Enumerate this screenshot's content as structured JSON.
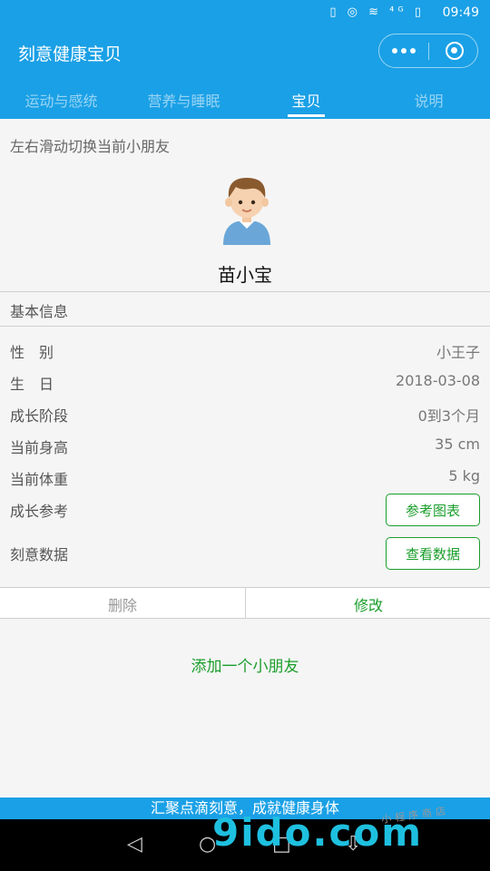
{
  "status_bar": {
    "icons": "▯ ◎ ≋ ⁴ᴳ ▯",
    "time": "09:49"
  },
  "header": {
    "title": "刻意健康宝贝"
  },
  "tabs": [
    {
      "label": "运动与感统",
      "active": false
    },
    {
      "label": "营养与睡眠",
      "active": false
    },
    {
      "label": "宝贝",
      "active": true
    },
    {
      "label": "说明",
      "active": false
    }
  ],
  "hint": "左右滑动切换当前小朋友",
  "baby": {
    "name": "苗小宝"
  },
  "info": {
    "section_title": "基本信息",
    "rows": [
      {
        "label": "性　别",
        "value": "小王子"
      },
      {
        "label": "生　日",
        "value": "2018-03-08"
      },
      {
        "label": "成长阶段",
        "value": "0到3个月"
      },
      {
        "label": "当前身高",
        "value": "35 cm"
      },
      {
        "label": "当前体重",
        "value": "5 kg"
      }
    ],
    "growth_ref": {
      "label": "成长参考",
      "button": "参考图表"
    },
    "deliberate_data": {
      "label": "刻意数据",
      "button": "查看数据"
    }
  },
  "actions": {
    "delete": "删除",
    "edit": "修改"
  },
  "add_kid": "添加一个小朋友",
  "footer_banner": "汇聚点滴刻意，成就健康身体",
  "nav": {
    "back": "◁",
    "home": "○",
    "recent": "□",
    "menu": "⇩"
  },
  "watermark": {
    "main": "9ido",
    "dotcom": ".com",
    "small": "小程序商店"
  },
  "colors": {
    "primary": "#1aa0e6",
    "accent_green": "#1a9e2b"
  }
}
